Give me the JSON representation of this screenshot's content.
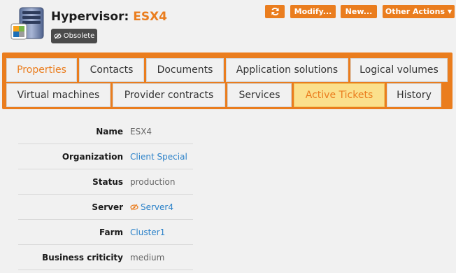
{
  "header": {
    "title_prefix": "Hypervisor: ",
    "title_name": "ESX4",
    "status_badge": "Obsolete"
  },
  "toolbar": {
    "refresh_icon": "refresh-icon",
    "modify_label": "Modify...",
    "new_label": "New...",
    "other_actions_label": "Other Actions"
  },
  "tabs": [
    {
      "label": "Properties"
    },
    {
      "label": "Contacts"
    },
    {
      "label": "Documents"
    },
    {
      "label": "Application solutions"
    },
    {
      "label": "Logical volumes"
    },
    {
      "label": "Virtual machines"
    },
    {
      "label": "Provider contracts"
    },
    {
      "label": "Services"
    },
    {
      "label": "Active Tickets"
    },
    {
      "label": "History"
    }
  ],
  "properties": [
    {
      "label": "Name",
      "value": "ESX4"
    },
    {
      "label": "Organization",
      "value": "Client Special"
    },
    {
      "label": "Status",
      "value": "production"
    },
    {
      "label": "Server",
      "value": "Server4"
    },
    {
      "label": "Farm",
      "value": "Cluster1"
    },
    {
      "label": "Business criticity",
      "value": "medium"
    }
  ],
  "colors": {
    "accent": "#ea7d1e",
    "link": "#2c82c9",
    "highlight_tab": "#fbe08c",
    "badge": "#4b4b4b"
  }
}
